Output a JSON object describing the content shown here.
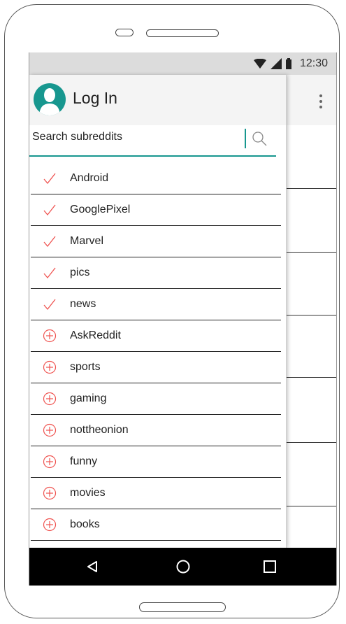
{
  "status_bar": {
    "time": "12:30",
    "icons": [
      "wifi-icon",
      "signal-icon",
      "battery-icon"
    ]
  },
  "drawer": {
    "login_label": "Log In",
    "search_placeholder": "Search subreddits",
    "items": [
      {
        "label": "Android",
        "state": "subscribed",
        "icon": "check-icon"
      },
      {
        "label": "GooglePixel",
        "state": "subscribed",
        "icon": "check-icon"
      },
      {
        "label": "Marvel",
        "state": "subscribed",
        "icon": "check-icon"
      },
      {
        "label": "pics",
        "state": "subscribed",
        "icon": "check-icon"
      },
      {
        "label": "news",
        "state": "subscribed",
        "icon": "check-icon"
      },
      {
        "label": "AskReddit",
        "state": "not-subscribed",
        "icon": "add-circle-icon"
      },
      {
        "label": "sports",
        "state": "not-subscribed",
        "icon": "add-circle-icon"
      },
      {
        "label": "gaming",
        "state": "not-subscribed",
        "icon": "add-circle-icon"
      },
      {
        "label": "nottheonion",
        "state": "not-subscribed",
        "icon": "add-circle-icon"
      },
      {
        "label": "funny",
        "state": "not-subscribed",
        "icon": "add-circle-icon"
      },
      {
        "label": "movies",
        "state": "not-subscribed",
        "icon": "add-circle-icon"
      },
      {
        "label": "books",
        "state": "not-subscribed",
        "icon": "add-circle-icon"
      }
    ]
  },
  "nav_bar": {
    "buttons": [
      "back-icon",
      "home-icon",
      "recents-icon"
    ]
  },
  "colors": {
    "accent": "#17978f",
    "icon_red": "#ef5350",
    "status_bar": "#dcdcdc",
    "header_bg": "#f4f4f4",
    "nav_bar": "#000000"
  }
}
